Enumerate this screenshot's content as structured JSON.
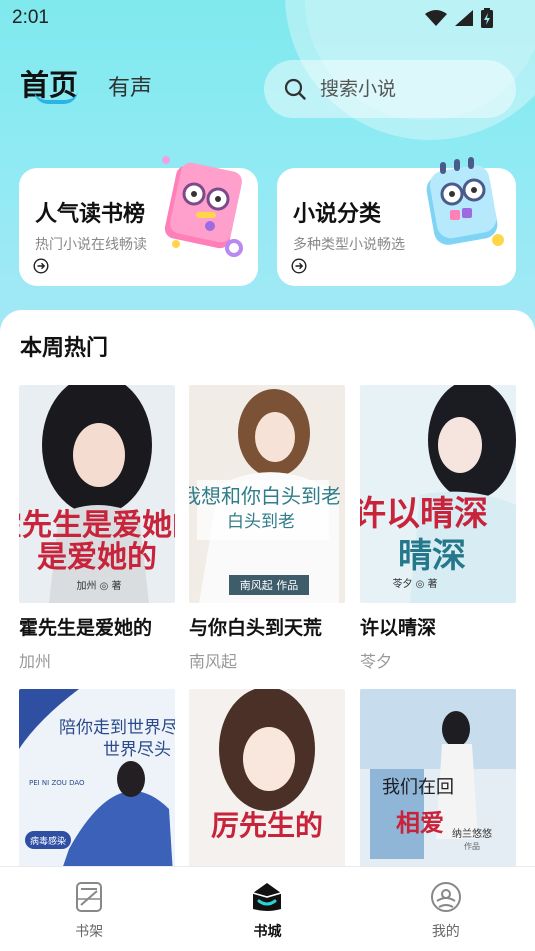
{
  "status_bar": {
    "time": "2:01"
  },
  "header": {
    "tab_home": "首页",
    "tab_audio": "有声",
    "search_placeholder": "搜索小说"
  },
  "cards": [
    {
      "title": "人气读书榜",
      "subtitle": "热门小说在线畅读"
    },
    {
      "title": "小说分类",
      "subtitle": "多种类型小说畅选"
    }
  ],
  "section": {
    "title": "本周热门"
  },
  "books_row1": [
    {
      "title": "霍先生是爱她的",
      "author": "加州",
      "cover_text": "霍先生是爱她的",
      "cover_author": "加州",
      "cover_mark": "著"
    },
    {
      "title": "与你白头到天荒",
      "author": "南风起",
      "cover_text": "我想和你白头到老",
      "cover_author": "南风起",
      "cover_mark": "作品"
    },
    {
      "title": "许以晴深",
      "author": "苓夕",
      "cover_text": "许以晴深",
      "cover_author": "苓夕",
      "cover_mark": "著"
    }
  ],
  "books_row2": [
    {
      "cover_text": "陪你走到世界尽头",
      "cover_en": "PEI NI ZOU DAO",
      "cover_badge": "病毒感染"
    },
    {
      "cover_text": "厉先生的"
    },
    {
      "cover_text": "我们在回",
      "cover_text2": "相爱",
      "cover_author": "纳兰悠悠",
      "cover_mark": "作品"
    }
  ],
  "bottom_nav": [
    {
      "label": "书架",
      "icon": "bookshelf-icon"
    },
    {
      "label": "书城",
      "icon": "bookstore-icon"
    },
    {
      "label": "我的",
      "icon": "profile-icon"
    }
  ],
  "colors": {
    "hero_start": "#7fe9ee",
    "hero_end": "#a6e8f6",
    "accent": "#2bb3e8"
  }
}
